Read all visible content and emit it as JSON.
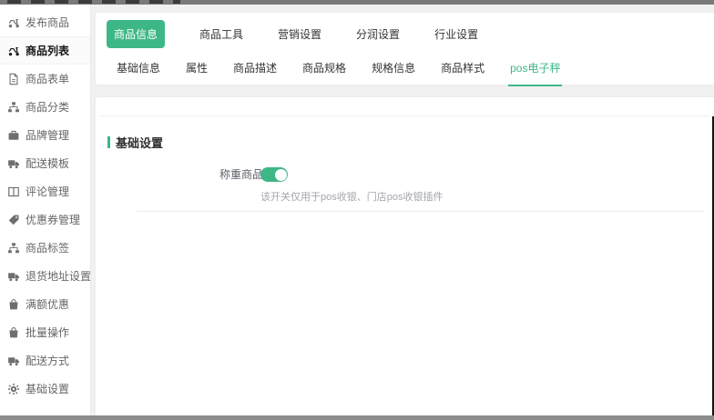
{
  "colors": {
    "accent": "#3eb786",
    "sidebar_text": "#666666",
    "muted_text": "#a3a6ad"
  },
  "sidebar": {
    "items": [
      {
        "label": "发布商品",
        "icon": "scooter-icon",
        "active": false
      },
      {
        "label": "商品列表",
        "icon": "scooter-icon",
        "active": true
      },
      {
        "label": "商品表单",
        "icon": "file-icon",
        "active": false
      },
      {
        "label": "商品分类",
        "icon": "sitemap-icon",
        "active": false
      },
      {
        "label": "品牌管理",
        "icon": "briefcase-icon",
        "active": false
      },
      {
        "label": "配送模板",
        "icon": "truck-icon",
        "active": false
      },
      {
        "label": "评论管理",
        "icon": "columns-icon",
        "active": false
      },
      {
        "label": "优惠券管理",
        "icon": "tag-icon",
        "active": false
      },
      {
        "label": "商品标签",
        "icon": "sitemap-icon",
        "active": false
      },
      {
        "label": "退货地址设置",
        "icon": "truck-icon",
        "active": false
      },
      {
        "label": "满额优惠",
        "icon": "bag-icon",
        "active": false
      },
      {
        "label": "批量操作",
        "icon": "bag-icon",
        "active": false
      },
      {
        "label": "配送方式",
        "icon": "truck-icon",
        "active": false
      },
      {
        "label": "基础设置",
        "icon": "gear-icon",
        "active": false
      }
    ]
  },
  "top_tabs": {
    "items": [
      {
        "label": "商品信息",
        "active": true
      },
      {
        "label": "商品工具",
        "active": false
      },
      {
        "label": "营销设置",
        "active": false
      },
      {
        "label": "分润设置",
        "active": false
      },
      {
        "label": "行业设置",
        "active": false
      }
    ]
  },
  "sub_tabs": {
    "items": [
      {
        "label": "基础信息",
        "active": false
      },
      {
        "label": "属性",
        "active": false
      },
      {
        "label": "商品描述",
        "active": false
      },
      {
        "label": "商品规格",
        "active": false
      },
      {
        "label": "规格信息",
        "active": false
      },
      {
        "label": "商品样式",
        "active": false
      },
      {
        "label": "pos电子秤",
        "active": true
      }
    ]
  },
  "content": {
    "section_title": "基础设置",
    "form": {
      "label": "称重商品",
      "toggle_state": "on",
      "helper": "该开关仅用于pos收银、门店pos收银插件"
    }
  }
}
